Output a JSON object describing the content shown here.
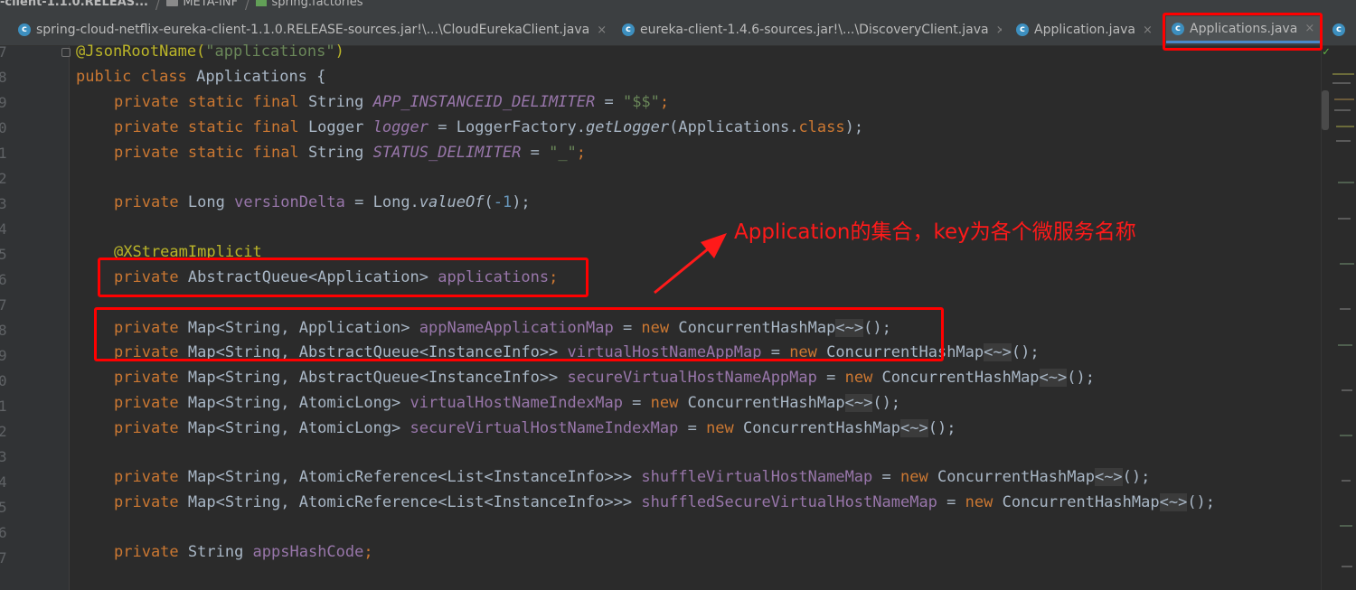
{
  "breadcrumb": {
    "module": "-client-1.1.0.RELEAS...",
    "folder": "META-INF",
    "file": "spring.factories"
  },
  "tabs": [
    {
      "label": "spring-cloud-netflix-eureka-client-1.1.0.RELEASE-sources.jar!\\...\\CloudEurekaClient.java",
      "icon": "class-icon",
      "active": false
    },
    {
      "label": "eureka-client-1.4.6-sources.jar!\\...\\DiscoveryClient.java",
      "icon": "class-icon",
      "active": false
    },
    {
      "label": "Application.java",
      "icon": "class-icon",
      "active": false
    },
    {
      "label": "Applications.java",
      "icon": "class-icon",
      "active": true
    }
  ],
  "tab_close_glyph": "×",
  "tab_icon_letter": "c",
  "line_numbers": [
    "7",
    "8",
    "9",
    "0",
    "1",
    "2",
    "3",
    "4",
    "5",
    "6",
    "7",
    "8",
    "9",
    "0",
    "1",
    "2",
    "3",
    "4",
    "5",
    "6",
    "7"
  ],
  "code": {
    "l7": {
      "annotation": "@JsonRootName(",
      "arg": "\"applications\"",
      "close": ")"
    },
    "l8": {
      "k1": "public",
      "k2": "class",
      "name": " Applications {"
    },
    "l9": {
      "mods": "private static final",
      "type": " String ",
      "const": "APP_INSTANCEID_DELIMITER",
      "eq": " = ",
      "val": "\"$$\"",
      "end": ";"
    },
    "l10": {
      "mods": "private static final",
      "type": " Logger ",
      "field": "logger",
      "eq": " = LoggerFactory.",
      "method": "getLogger",
      "args": "(Applications.",
      "kw": "class",
      "end": ");"
    },
    "l11": {
      "mods": "private static final",
      "type": " String ",
      "const": "STATUS_DELIMITER",
      "eq": " = ",
      "val": "\"_\"",
      "end": ";"
    },
    "l13": {
      "mod": "private",
      "type": " Long ",
      "field": "versionDelta",
      "eq": " = Long.",
      "method": "valueOf",
      "open": "(",
      "num": "-1",
      "end": ");"
    },
    "l15": {
      "annotation": "@XStreamImplicit"
    },
    "l16": {
      "mod": "private",
      "type": " AbstractQueue<Application> ",
      "field": "applications",
      "end": ";"
    },
    "l18": {
      "mod": "private",
      "type": " Map<String, Application> ",
      "field": "appNameApplicationMap",
      "eq": " = ",
      "kw": "new",
      "ctor": " ConcurrentHashMap",
      "dia": "<~>",
      "end": "();"
    },
    "l19": {
      "mod": "private",
      "type": " Map<String, AbstractQueue<InstanceInfo>> ",
      "field": "virtualHostNameAppMap",
      "eq": " = ",
      "kw": "new",
      "ctor": " ConcurrentHashMap",
      "dia": "<~>",
      "end": "();"
    },
    "l20": {
      "mod": "private",
      "type": " Map<String, AbstractQueue<InstanceInfo>> ",
      "field": "secureVirtualHostNameAppMap",
      "eq": " = ",
      "kw": "new",
      "ctor": " ConcurrentHashMap",
      "dia": "<~>",
      "end": "();"
    },
    "l21": {
      "mod": "private",
      "type": " Map<String, AtomicLong> ",
      "field": "virtualHostNameIndexMap",
      "eq": " = ",
      "kw": "new",
      "ctor": " ConcurrentHashMap",
      "dia": "<~>",
      "end": "();"
    },
    "l22": {
      "mod": "private",
      "type": " Map<String, AtomicLong> ",
      "field": "secureVirtualHostNameIndexMap",
      "eq": " = ",
      "kw": "new",
      "ctor": " ConcurrentHashMap",
      "dia": "<~>",
      "end": "();"
    },
    "l24": {
      "mod": "private",
      "type": " Map<String, AtomicReference<List<InstanceInfo>>> ",
      "field": "shuffleVirtualHostNameMap",
      "eq": " = ",
      "kw": "new",
      "ctor": " ConcurrentHashMap",
      "dia": "<~>",
      "end": "();"
    },
    "l25": {
      "mod": "private",
      "type": " Map<String, AtomicReference<List<InstanceInfo>>> ",
      "field": "shuffledSecureVirtualHostNameMap",
      "eq": " = ",
      "kw": "new",
      "ctor": " ConcurrentHashMap",
      "dia": "<~>",
      "end": "();"
    },
    "l27": {
      "mod": "private",
      "type": " String ",
      "field": "appsHashCode",
      "end": ";"
    }
  },
  "annotation_note": "Application的集合，key为各个微服务名称",
  "colors": {
    "highlight": "#ff0000",
    "keyword": "#cc7832",
    "annotation": "#bbb529",
    "string": "#6a8759",
    "field": "#9876aa",
    "number": "#6897bb",
    "plain": "#a9b7c6",
    "background": "#2b2b2b"
  }
}
